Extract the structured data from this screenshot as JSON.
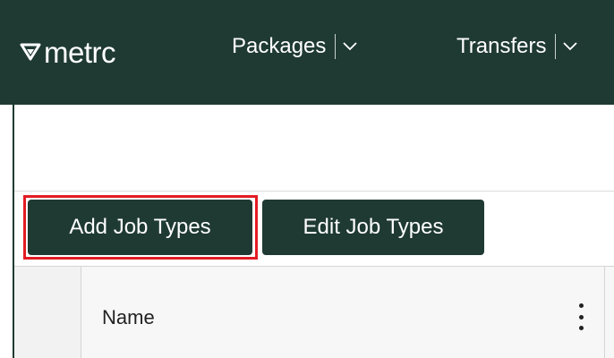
{
  "nav": {
    "logo_text": "metrc",
    "items": [
      {
        "label": "Packages"
      },
      {
        "label": "Transfers"
      }
    ]
  },
  "toolbar": {
    "add_label": "Add Job Types",
    "edit_label": "Edit Job Types"
  },
  "grid": {
    "columns": [
      {
        "header": "Name"
      }
    ]
  },
  "colors": {
    "brand": "#1f3a33",
    "highlight": "#e31c23"
  },
  "icons": {
    "logo": "metrc-logo-icon",
    "dropdown": "chevron-down-icon",
    "column_menu": "kebab-menu-icon"
  }
}
